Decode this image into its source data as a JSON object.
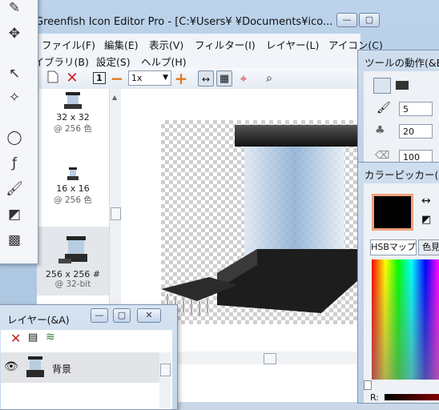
{
  "window": {
    "title": "Greenfish Icon Editor Pro - [C:¥Users¥        ¥Documents¥ico..."
  },
  "menu_row1": [
    {
      "label": "ファイル(F)"
    },
    {
      "label": "編集(E)"
    },
    {
      "label": "表示(V)"
    },
    {
      "label": "フィルター(I)"
    },
    {
      "label": "レイヤー(L)"
    },
    {
      "label": "アイコン(C)"
    }
  ],
  "menu_row2": [
    {
      "label": "ライブラリ(B)"
    },
    {
      "label": "設定(S)"
    },
    {
      "label": "ヘルプ(H)"
    }
  ],
  "toolbar": {
    "zoom_value": "1x",
    "page_number": "1"
  },
  "icon_list": [
    {
      "size": "32 x 32",
      "depth": "@ 256 色"
    },
    {
      "size": "16 x 16",
      "depth": "@ 256 色"
    },
    {
      "size": "256 x 256 #",
      "depth": "@ 32-bit"
    }
  ],
  "layers_window": {
    "title": "レイヤー(&A)",
    "layer_name": "背景"
  },
  "tool_options": {
    "title": "ツールの動作(&B",
    "brush_size": "5",
    "opacity": "20",
    "value3": "100"
  },
  "color_picker": {
    "title": "カラーピッカー(&",
    "tab_hsb": "HSBマップ",
    "tab_other": "色見",
    "r_label": "R:",
    "current_color": "#000000"
  },
  "colors": {
    "accent_border": "#f3a07a",
    "delete_red": "#cc2222",
    "zoom_orange": "#e07a20"
  }
}
